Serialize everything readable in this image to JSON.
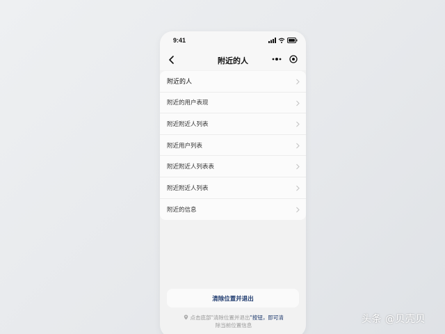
{
  "status_bar": {
    "time": "9:41"
  },
  "nav": {
    "title": "附近的人"
  },
  "list": {
    "items": [
      {
        "label": "附近的人"
      },
      {
        "label": "附近的用户表现"
      },
      {
        "label": "附近附近人列表"
      },
      {
        "label": "附近用户列表"
      },
      {
        "label": "附近附近人列表表"
      },
      {
        "label": "附近附近人列表"
      },
      {
        "label": "附近的信息"
      }
    ]
  },
  "footer": {
    "button_label": "清除位置并退出",
    "hint_prefix": "点击底部\"",
    "hint_highlight": "清除位置并退出",
    "hint_suffix_blue": "\"按钮，即可清",
    "hint_line2": "除当前位置信息"
  },
  "watermark": "头条 @贝壳贝",
  "colors": {
    "accent": "#1e3a6e",
    "background": "#e9ebee",
    "card": "#fbfbfb"
  }
}
